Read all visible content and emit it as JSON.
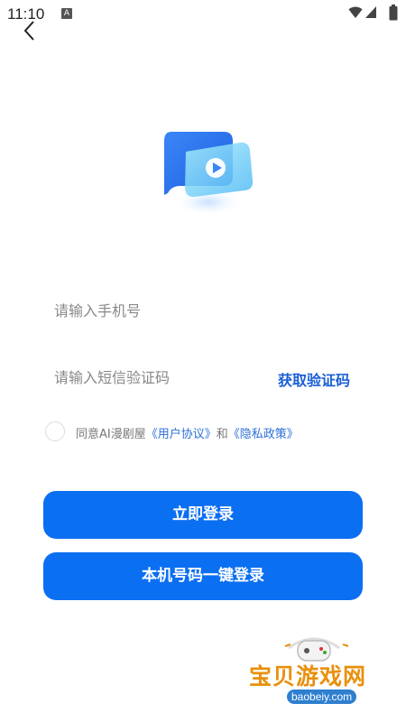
{
  "status_bar": {
    "time": "11:10",
    "notification_icon": "A"
  },
  "nav": {
    "back_icon": "back-chevron-icon"
  },
  "logo": {
    "icon": "video-play-icon",
    "colors": {
      "primary": "#2f7bf5",
      "secondary": "#6fd8f5"
    }
  },
  "form": {
    "phone_placeholder": "请输入手机号",
    "code_placeholder": "请输入短信验证码",
    "get_code_label": "获取验证码"
  },
  "agreement": {
    "prefix": "同意AI漫剧屋",
    "user_agreement": "《用户协议》",
    "and": "和",
    "privacy_policy": "《隐私政策》"
  },
  "buttons": {
    "login": "立即登录",
    "one_click_login": "本机号码一键登录"
  },
  "watermark": {
    "title": "宝贝游戏网",
    "domain": "baobeiy.com"
  },
  "colors": {
    "accent": "#0b6ff2",
    "link": "#2d6fd8"
  }
}
